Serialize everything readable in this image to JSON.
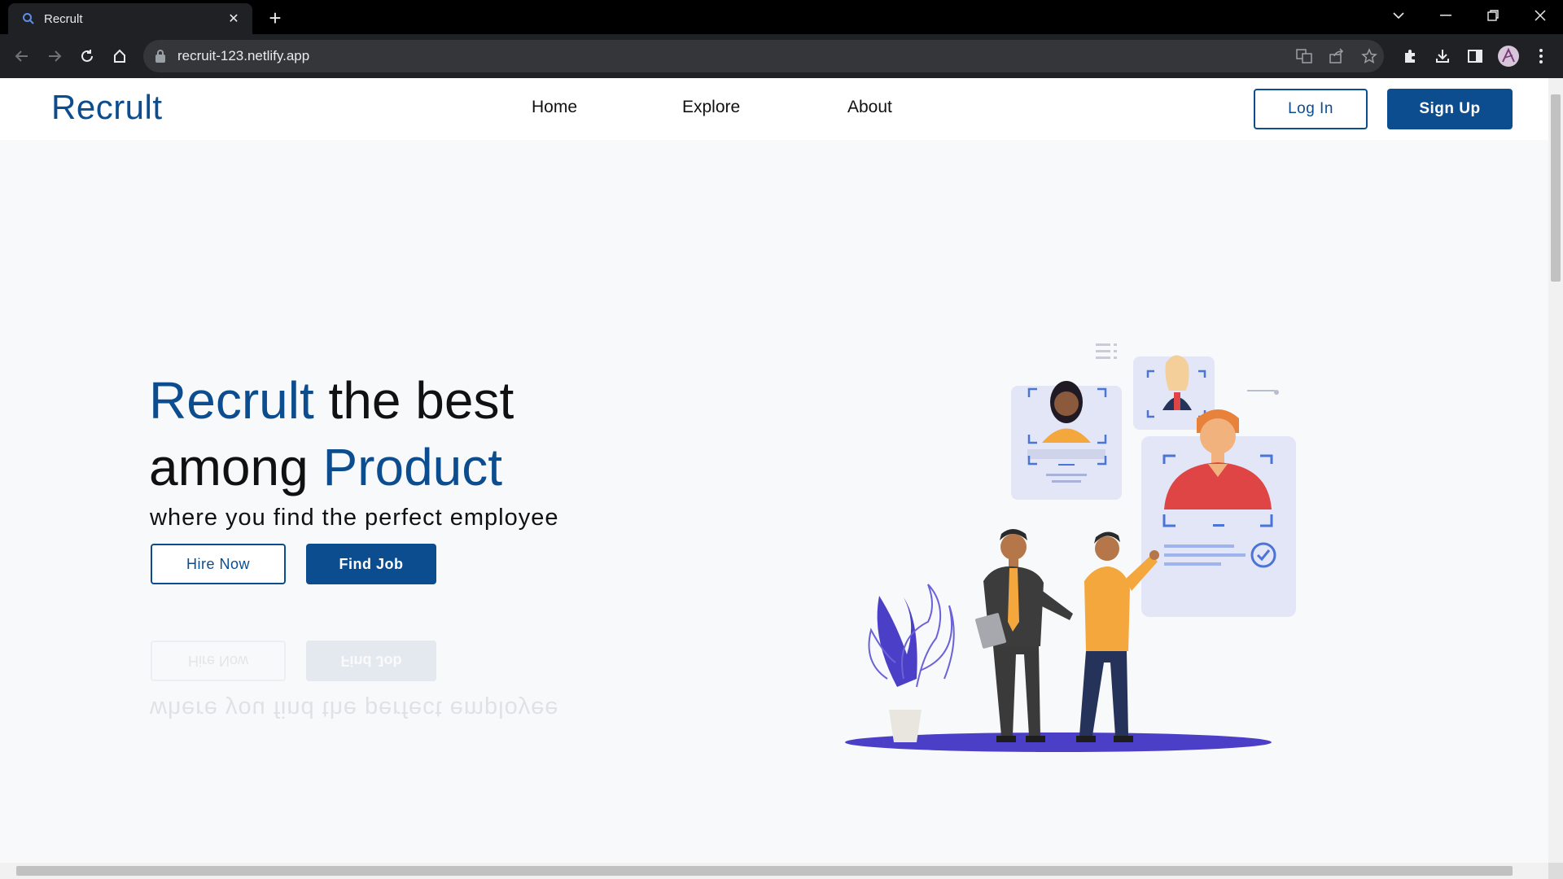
{
  "browser": {
    "tab_title": "Recrult",
    "url": "recruit-123.netlify.app"
  },
  "navbar": {
    "brand": "Recrult",
    "links": [
      "Home",
      "Explore",
      "About"
    ],
    "login_label": "Log In",
    "signup_label": "Sign Up"
  },
  "hero": {
    "title_word1": "Recrult",
    "title_rest1": " the best",
    "title_word2": "among ",
    "title_word3": "Product",
    "subtitle": "where you find the perfect employee",
    "hire_label": "Hire Now",
    "find_label": "Find Job"
  },
  "colors": {
    "brand_blue": "#0b4d8f",
    "page_bg": "#f8f9fa",
    "chrome_dark": "#202124"
  },
  "icons": [
    "search-icon",
    "close-icon",
    "plus-icon",
    "back-icon",
    "forward-icon",
    "reload-icon",
    "home-icon",
    "lock-icon",
    "translate-icon",
    "share-icon",
    "star-icon",
    "extensions-icon",
    "download-icon",
    "sidepanel-icon",
    "profile-avatar",
    "kebab-menu-icon"
  ]
}
